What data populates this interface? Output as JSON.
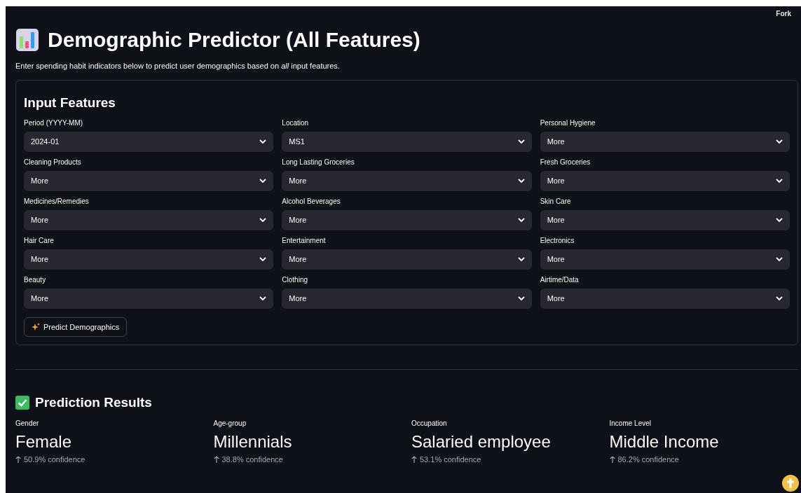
{
  "header": {
    "fork_link": "Fork"
  },
  "title": "Demographic Predictor (All Features)",
  "subtitle": "Enter spending habit indicators below to predict user demographics based on *all* input features.",
  "form": {
    "heading": "Input Features",
    "fields": [
      {
        "label": "Period (YYYY-MM)",
        "value": "2024-01"
      },
      {
        "label": "Location",
        "value": "MS1"
      },
      {
        "label": "Personal Hygiene",
        "value": "More"
      },
      {
        "label": "Cleaning Products",
        "value": "More"
      },
      {
        "label": "Long Lasting Groceries",
        "value": "More"
      },
      {
        "label": "Fresh Groceries",
        "value": "More"
      },
      {
        "label": "Medicines/Remedies",
        "value": "More"
      },
      {
        "label": "Alcohol Beverages",
        "value": "More"
      },
      {
        "label": "Skin Care",
        "value": "More"
      },
      {
        "label": "Hair Care",
        "value": "More"
      },
      {
        "label": "Entertainment",
        "value": "More"
      },
      {
        "label": "Electronics",
        "value": "More"
      },
      {
        "label": "Beauty",
        "value": "More"
      },
      {
        "label": "Clothing",
        "value": "More"
      },
      {
        "label": "Airtime/Data",
        "value": "More"
      }
    ],
    "submit_button": "Predict Demographics"
  },
  "results": {
    "heading": "Prediction Results",
    "metrics": [
      {
        "label": "Gender",
        "value": "Female",
        "delta": "50.9% confidence"
      },
      {
        "label": "Age-group",
        "value": "Millennials",
        "delta": "38.8% confidence"
      },
      {
        "label": "Occupation",
        "value": "Salaried employee",
        "delta": "53.1% confidence"
      },
      {
        "label": "Income Level",
        "value": "Middle Income",
        "delta": "86.2% confidence"
      }
    ]
  }
}
